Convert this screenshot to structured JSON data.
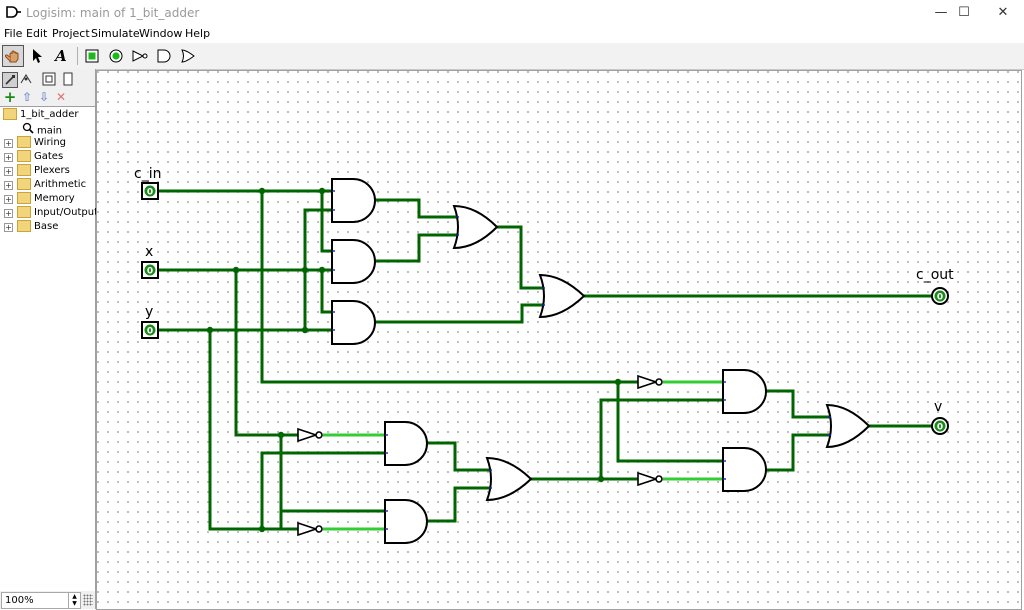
{
  "window": {
    "title": "Logisim: main of 1_bit_adder",
    "controls": [
      "—",
      "☐",
      "✕"
    ]
  },
  "menu": [
    "File",
    "Edit",
    "Project",
    "Simulate",
    "Window",
    "Help"
  ],
  "toolbar": {
    "tools": [
      "poke-tool",
      "select-tool",
      "text-tool",
      "input-pin",
      "output-pin",
      "not-gate",
      "and-gate",
      "or-gate"
    ],
    "text_tool_label": "A"
  },
  "explorer": {
    "project": "1_bit_adder",
    "circuit": "main",
    "libraries": [
      "Wiring",
      "Gates",
      "Plexers",
      "Arithmetic",
      "Memory",
      "Input/Output",
      "Base"
    ]
  },
  "zoom": {
    "value": "100%"
  },
  "circuit": {
    "pins": {
      "c_in": {
        "label": "c_in",
        "value": "0"
      },
      "x": {
        "label": "x",
        "value": "0"
      },
      "y": {
        "label": "y",
        "value": "0"
      },
      "c_out": {
        "label": "c_out",
        "value": "0"
      },
      "v": {
        "label": "v",
        "value": "0"
      }
    },
    "colors": {
      "wire_low": "#006400",
      "wire_high": "#33cc33",
      "gate_stroke": "#000000",
      "pin_stub": "#2020c0"
    }
  }
}
